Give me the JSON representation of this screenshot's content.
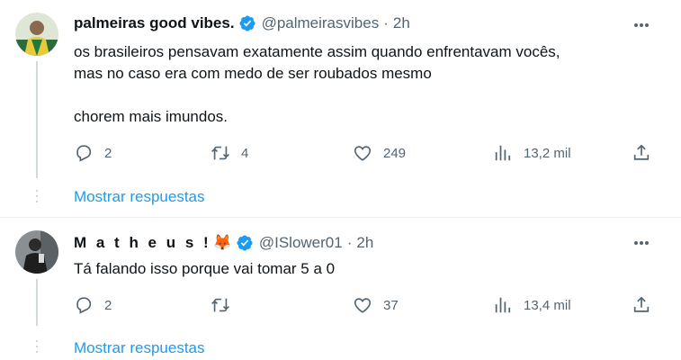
{
  "tweets": [
    {
      "name": "palmeiras good vibes.",
      "handle": "@palmeirasvibes",
      "separator": "·",
      "time": "2h",
      "text_line1": "os brasileiros pensavam exatamente assim quando enfrentavam vocês,",
      "text_line2": "mas no caso era com medo de ser roubados mesmo",
      "text_line3": "chorem mais imundos.",
      "replies": "2",
      "retweets": "4",
      "likes": "249",
      "views": "13,2 mil",
      "show_replies": "Mostrar respuestas"
    },
    {
      "name": "M a t h e u s !",
      "emoji": "🦊",
      "handle": "@ISlower01",
      "separator": "·",
      "time": "2h",
      "text_line1": "Tá falando isso porque vai tomar 5 a 0",
      "replies": "2",
      "retweets": "",
      "likes": "37",
      "views": "13,4 mil",
      "show_replies": "Mostrar respuestas"
    }
  ],
  "colors": {
    "accent": "#1d9bf0",
    "text": "#0f1419",
    "muted": "#536471",
    "line": "#cfd9de"
  },
  "icons": [
    "more-icon",
    "verified-badge-icon",
    "reply-icon",
    "retweet-icon",
    "like-icon",
    "views-icon",
    "share-icon"
  ]
}
